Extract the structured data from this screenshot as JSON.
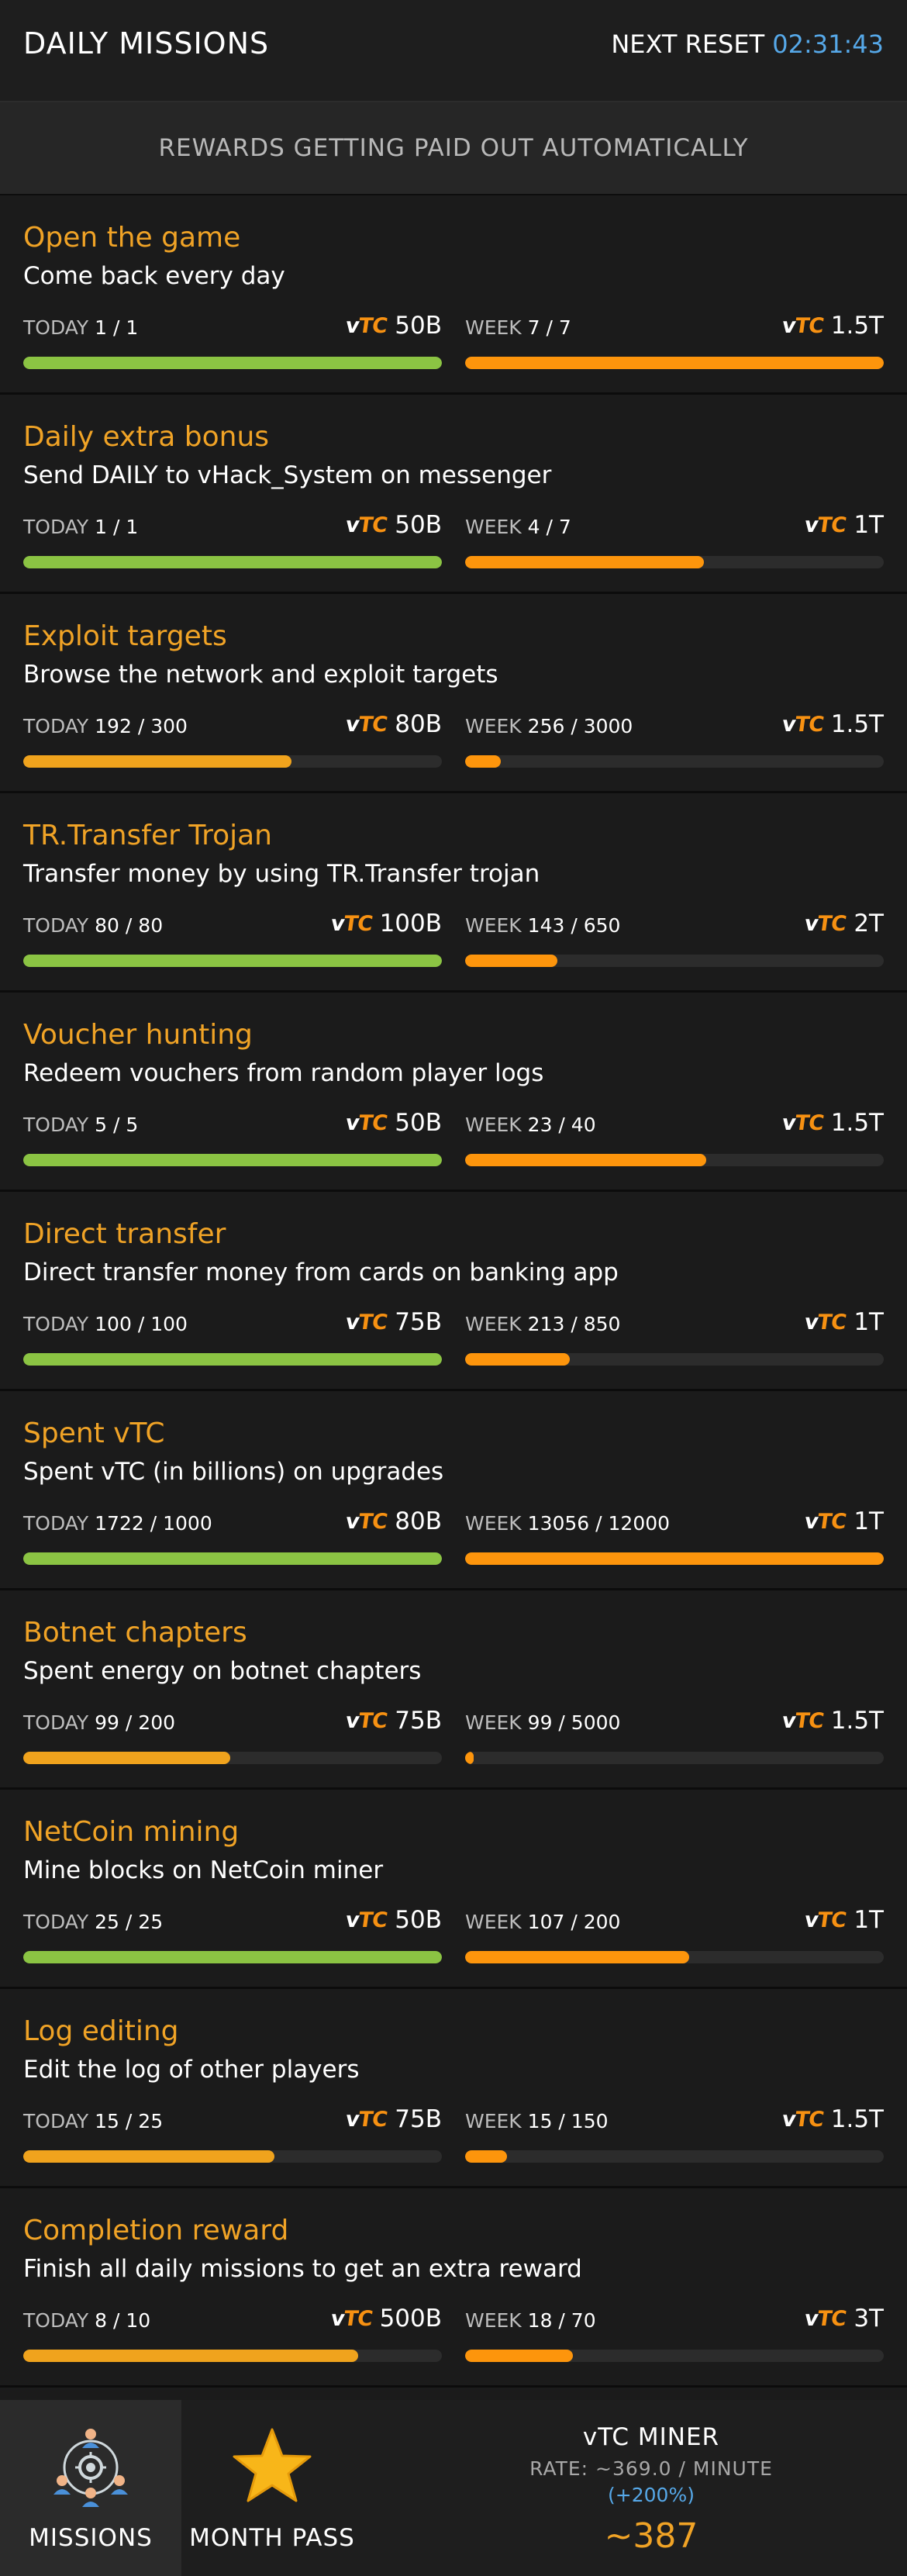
{
  "header": {
    "title": "DAILY MISSIONS",
    "reset_label": "NEXT RESET",
    "reset_time": "02:31:43"
  },
  "banner": {
    "text": "REWARDS GETTING PAID OUT AUTOMATICALLY"
  },
  "currency": {
    "v": "v",
    "tc": "TC"
  },
  "progress_labels": {
    "today": "TODAY",
    "week": "WEEK"
  },
  "colors": {
    "accent": "#f0a326",
    "today_complete": "#8bc443",
    "today_partial": "#f0a31d",
    "week": "#fd950c",
    "timer": "#56a8e8"
  },
  "missions": [
    {
      "title": "Open the game",
      "desc": "Come back every day",
      "today": {
        "count": "1 / 1",
        "reward": "50B",
        "progress": 1.0,
        "complete": true
      },
      "week": {
        "count": "7 / 7",
        "reward": "1.5T",
        "progress": 1.0
      }
    },
    {
      "title": "Daily extra bonus",
      "desc": "Send DAILY to vHack_System on messenger",
      "today": {
        "count": "1 / 1",
        "reward": "50B",
        "progress": 1.0,
        "complete": true
      },
      "week": {
        "count": "4 / 7",
        "reward": "1T",
        "progress": 0.571
      }
    },
    {
      "title": "Exploit targets",
      "desc": "Browse the network and exploit targets",
      "today": {
        "count": "192 / 300",
        "reward": "80B",
        "progress": 0.64,
        "complete": false
      },
      "week": {
        "count": "256 / 3000",
        "reward": "1.5T",
        "progress": 0.085
      }
    },
    {
      "title": "TR.Transfer Trojan",
      "desc": "Transfer money by using TR.Transfer trojan",
      "today": {
        "count": "80 / 80",
        "reward": "100B",
        "progress": 1.0,
        "complete": true
      },
      "week": {
        "count": "143 / 650",
        "reward": "2T",
        "progress": 0.22
      }
    },
    {
      "title": "Voucher hunting",
      "desc": "Redeem vouchers from random player logs",
      "today": {
        "count": "5 / 5",
        "reward": "50B",
        "progress": 1.0,
        "complete": true
      },
      "week": {
        "count": "23 / 40",
        "reward": "1.5T",
        "progress": 0.575
      }
    },
    {
      "title": "Direct transfer",
      "desc": "Direct transfer money from cards on banking app",
      "today": {
        "count": "100 / 100",
        "reward": "75B",
        "progress": 1.0,
        "complete": true
      },
      "week": {
        "count": "213 / 850",
        "reward": "1T",
        "progress": 0.25
      }
    },
    {
      "title": "Spent vTC",
      "desc": "Spent vTC (in billions) on upgrades",
      "today": {
        "count": "1722 / 1000",
        "reward": "80B",
        "progress": 1.0,
        "complete": true
      },
      "week": {
        "count": "13056 / 12000",
        "reward": "1T",
        "progress": 1.0
      }
    },
    {
      "title": "Botnet chapters",
      "desc": "Spent energy on botnet chapters",
      "today": {
        "count": "99 / 200",
        "reward": "75B",
        "progress": 0.495,
        "complete": false
      },
      "week": {
        "count": "99 / 5000",
        "reward": "1.5T",
        "progress": 0.02
      }
    },
    {
      "title": "NetCoin mining",
      "desc": "Mine blocks on NetCoin miner",
      "today": {
        "count": "25 / 25",
        "reward": "50B",
        "progress": 1.0,
        "complete": true
      },
      "week": {
        "count": "107 / 200",
        "reward": "1T",
        "progress": 0.535
      }
    },
    {
      "title": "Log editing",
      "desc": "Edit the log of other players",
      "today": {
        "count": "15 / 25",
        "reward": "75B",
        "progress": 0.6,
        "complete": false
      },
      "week": {
        "count": "15 / 150",
        "reward": "1.5T",
        "progress": 0.1
      }
    },
    {
      "title": "Completion reward",
      "desc": "Finish all daily missions to get an extra reward",
      "today": {
        "count": "8 / 10",
        "reward": "500B",
        "progress": 0.8,
        "complete": false
      },
      "week": {
        "count": "18 / 70",
        "reward": "3T",
        "progress": 0.257
      }
    }
  ],
  "footer": {
    "missions_label": "MISSIONS",
    "month_pass_label": "MONTH PASS",
    "miner_title": "vTC MINER",
    "miner_rate": "RATE: ~369.0 / MINUTE",
    "miner_bonus": "(+200%)",
    "miner_amount": "~387",
    "missions_icon": "network-people-icon",
    "month_pass_icon": "star-icon"
  }
}
